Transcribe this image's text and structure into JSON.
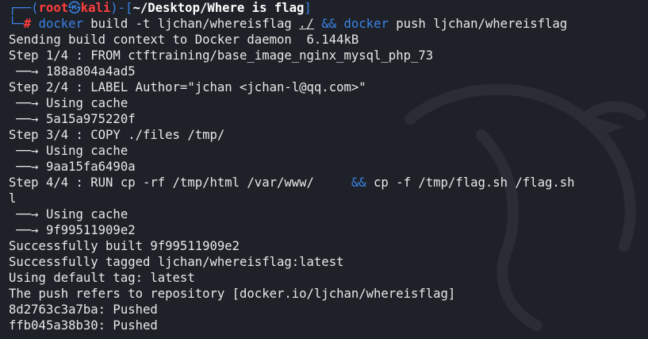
{
  "prompt": {
    "open": "┌──(",
    "user": "root",
    "at": "㉿",
    "host": "kali",
    "sep": ")-[",
    "cwd": "~/Desktop/Where is flag",
    "close": "]",
    "corner": "└─",
    "hash": "#"
  },
  "command": {
    "cmd1": "docker",
    "args1": " build -t ljchan/whereisflag ",
    "dot": "./",
    "and": " && ",
    "cmd2": "docker",
    "args2": " push ljchan/whereisflag"
  },
  "output": [
    "Sending build context to Docker daemon  6.144kB",
    "Step 1/4 : FROM ctftraining/base_image_nginx_mysql_php_73",
    " ──→ 188a804a4ad5",
    "Step 2/4 : LABEL Author=\"jchan <jchan-l@qq.com>\"",
    " ──→ Using cache",
    " ──→ 5a15a975220f",
    "Step 3/4 : COPY ./files /tmp/",
    " ──→ Using cache",
    " ──→ 9aa15fa6490a"
  ],
  "step4": {
    "pre": "Step 4/4 : RUN cp -rf /tmp/html /var/www/     ",
    "amp": "&&",
    "post": " cp -f /tmp/flag.sh /flag.sh",
    "wrap": "l"
  },
  "output2": [
    " ──→ Using cache",
    " ──→ 9f99511909e2",
    "Successfully built 9f99511909e2",
    "Successfully tagged ljchan/whereisflag:latest",
    "Using default tag: latest",
    "The push refers to repository [docker.io/ljchan/whereisflag]",
    "8d2763c3a7ba: Pushed",
    "ffb045a38b30: Pushed"
  ],
  "colors": {
    "background": "#1f2128",
    "prompt_blue": "#3a83e6",
    "prompt_red": "#ff3d3d",
    "text": "#e8e8e8"
  },
  "icons": {
    "watermark": "kali-dragon-icon"
  }
}
